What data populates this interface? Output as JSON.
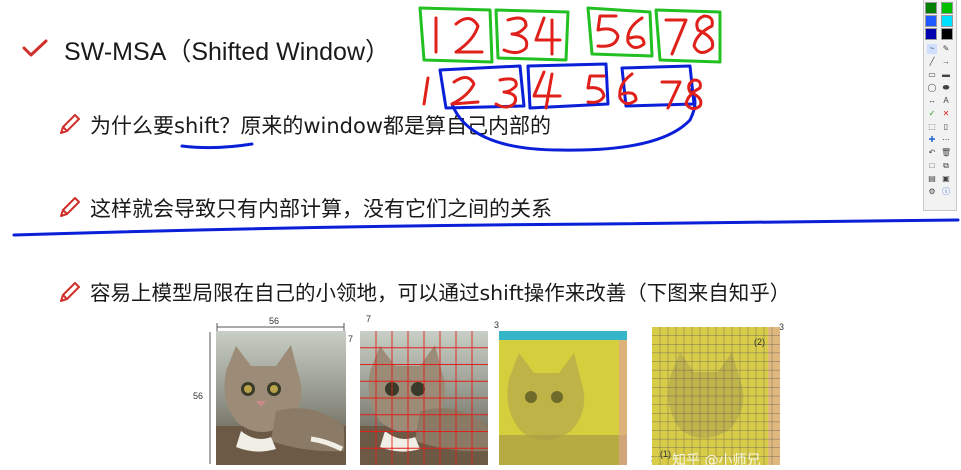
{
  "slide": {
    "heading": "SW-MSA（Shifted Window）",
    "bullets": [
      "为什么要shift？原来的window都是算自己内部的",
      "这样就会导致只有内部计算，没有它们之间的关系",
      "容易上模型局限在自己的小领地，可以通过shift操作来改善（下图来自知乎）"
    ]
  },
  "handwriting": {
    "top_row": [
      "12",
      "34",
      "56",
      "78"
    ],
    "bottom_row": [
      "1",
      "2",
      "3",
      "4",
      "5",
      "6",
      "7",
      "8"
    ]
  },
  "figure": {
    "label_width": "56",
    "label_height": "56",
    "label_patch": "7",
    "label_patch_side": "7",
    "label_shift_a": "3",
    "label_shift_b": "3",
    "label_shift_c": "3",
    "label_shift_d": "3",
    "label_region_2": "(2)",
    "label_region_1": "(1)",
    "watermark": "知乎 @小师兄"
  },
  "toolbar": {
    "colors": [
      "#008000",
      "#00c000",
      "#1e5aff",
      "#00e0ff",
      "#0000b0",
      "#000000"
    ],
    "tools": [
      "pen-icon",
      "line-icon",
      "arrow-icon",
      "rect-icon",
      "ellipse-icon",
      "text-icon",
      "check-icon",
      "close-icon",
      "undo-icon",
      "delete-icon",
      "save-icon",
      "print-icon",
      "info-icon"
    ]
  },
  "colors": {
    "pen_red": "#e0201a",
    "pen_green": "#22c022",
    "pen_blue": "#0a1fd8",
    "bullet_icon": "#d0302a"
  }
}
